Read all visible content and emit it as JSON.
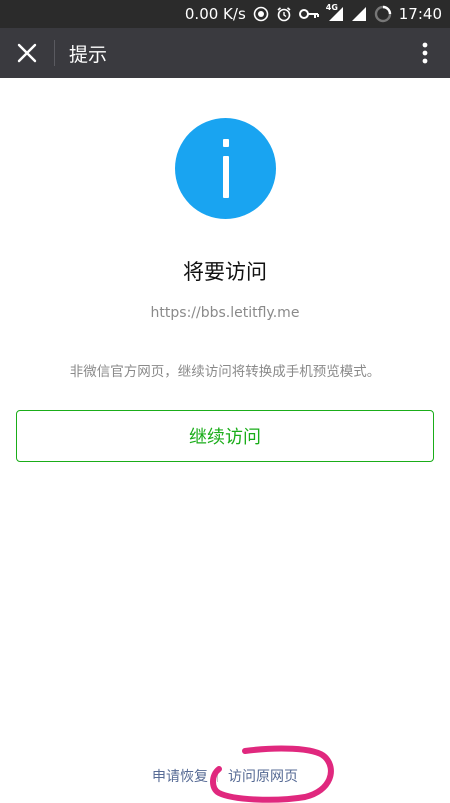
{
  "status_bar": {
    "net_speed": "0.00 K/s",
    "signal_label": "4G",
    "time": "17:40"
  },
  "title_bar": {
    "title": "提示"
  },
  "main": {
    "heading": "将要访问",
    "url": "https://bbs.letitfly.me",
    "notice": "非微信官方网页，继续访问将转换成手机预览模式。",
    "continue_label": "继续访问"
  },
  "footer": {
    "restore_label": "申请恢复",
    "visit_original_label": "访问原网页"
  },
  "colors": {
    "status_bar_bg": "#2b2b2b",
    "title_bar_bg": "#3a3a3f",
    "info_blue": "#19a4f1",
    "accent_green": "#1aad19",
    "link_blue": "#576b95",
    "annotation_pink": "#e0287e"
  }
}
